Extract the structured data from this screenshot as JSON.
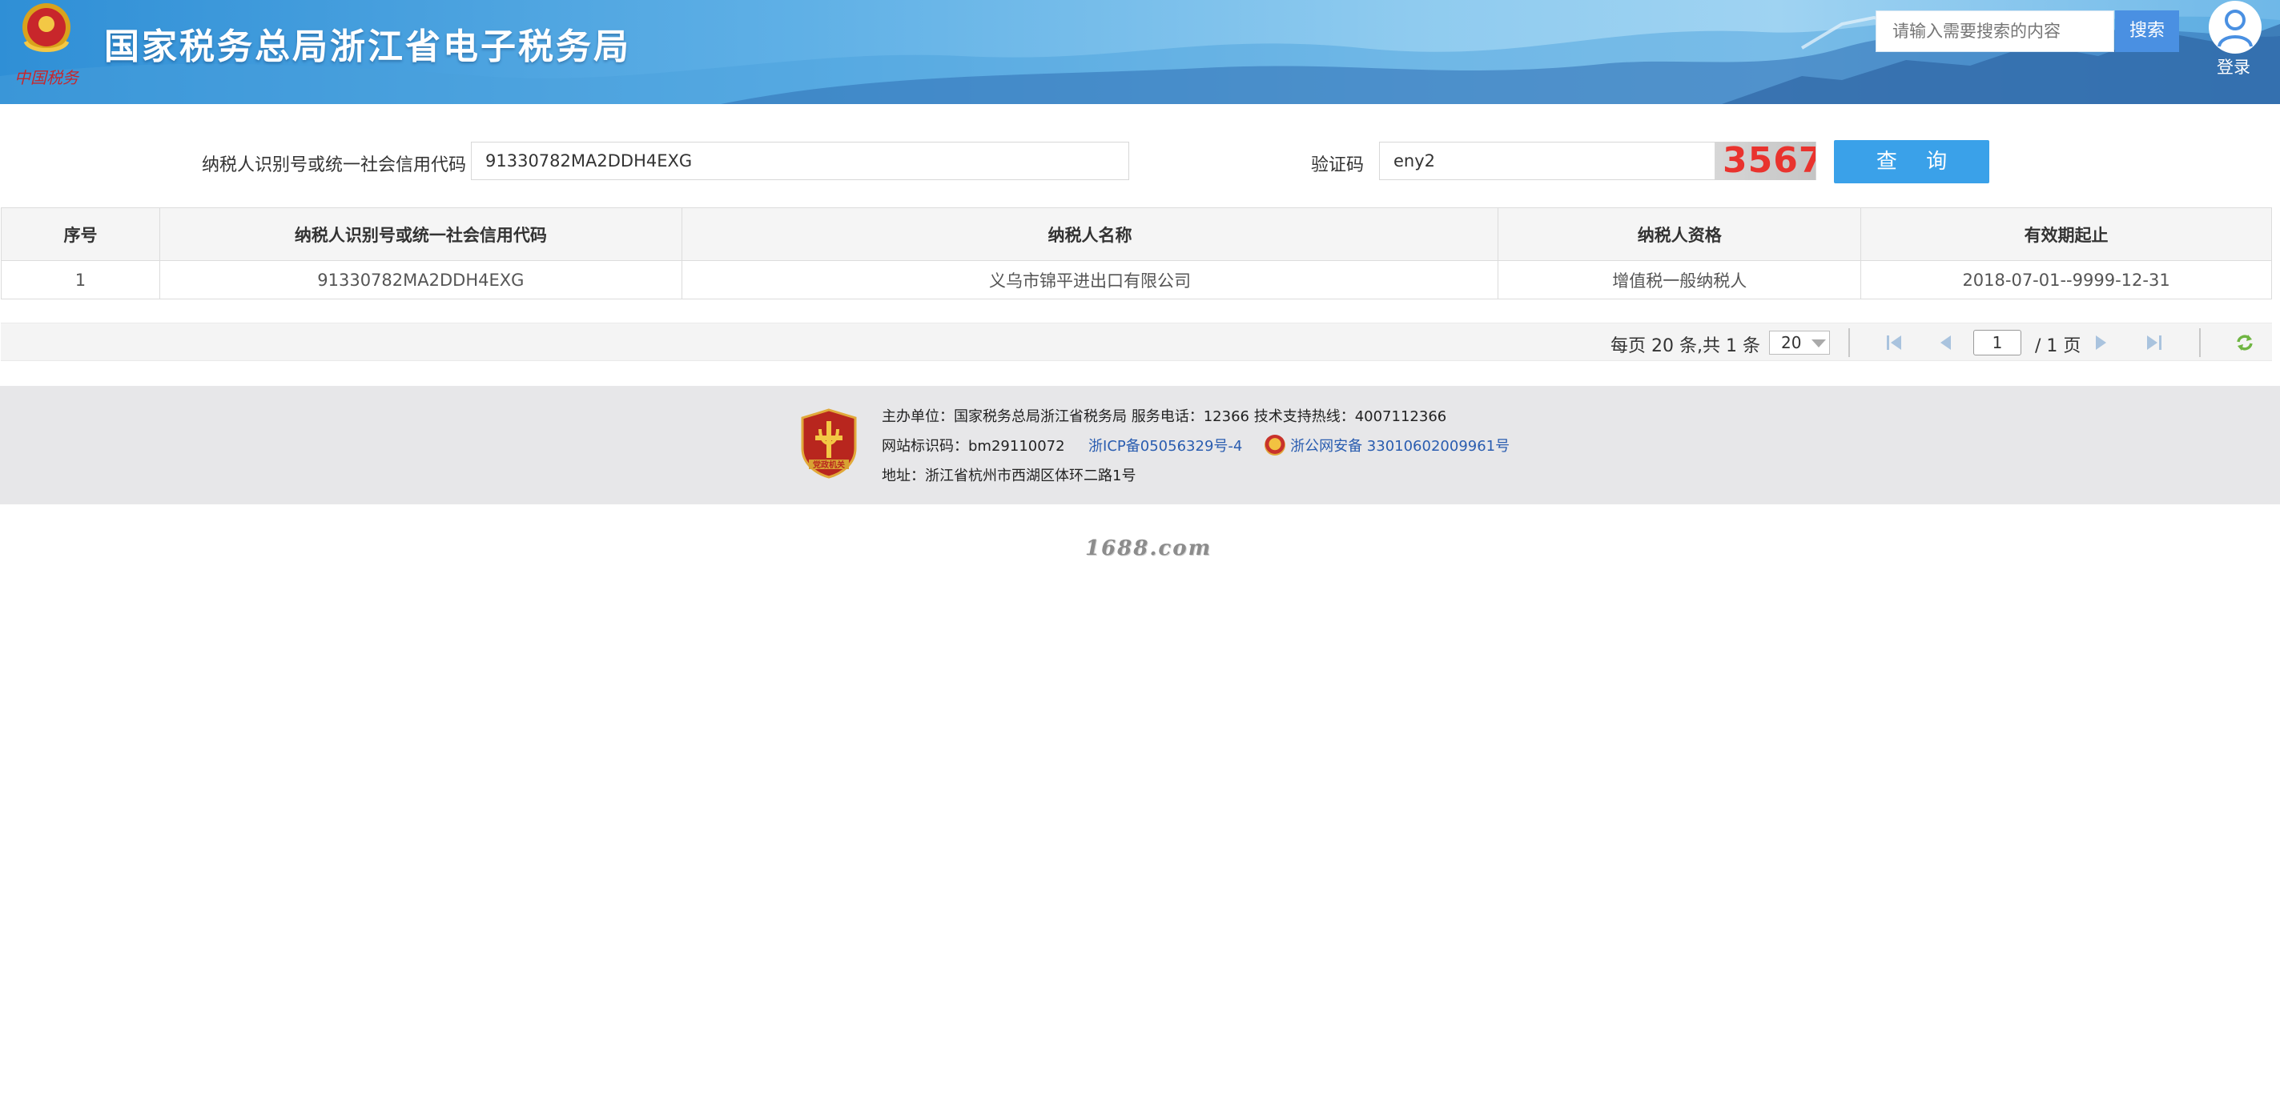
{
  "header": {
    "site_title": "国家税务总局浙江省电子税务局",
    "search_placeholder": "请输入需要搜索的内容",
    "search_button": "搜索",
    "login_label": "登录"
  },
  "query_form": {
    "taxpayer_id_label": "纳税人识别号或统一社会信用代码",
    "taxpayer_id_value": "91330782MA2DDH4EXG",
    "captcha_label": "验证码",
    "captcha_value": "eny2",
    "captcha_image_text": "3567",
    "query_button": "查 询"
  },
  "results_table": {
    "columns": [
      "序号",
      "纳税人识别号或统一社会信用代码",
      "纳税人名称",
      "纳税人资格",
      "有效期起止"
    ],
    "rows": [
      [
        "1",
        "91330782MA2DDH4EXG",
        "义乌市锦平进出口有限公司",
        "增值税一般纳税人",
        "2018-07-01--9999-12-31"
      ]
    ]
  },
  "pagination": {
    "summary": "每页 20 条,共 1 条",
    "page_size": "20",
    "current_page": "1",
    "total_pages": "/ 1 页"
  },
  "footer": {
    "line1": "主办单位：国家税务总局浙江省税务局     服务电话：12366     技术支持热线：4007112366",
    "site_code": "网站标识码：bm29110072",
    "icp": "浙ICP备05056329号-4",
    "police": "浙公网安备 33010602009961号",
    "address": "地址：浙江省杭州市西湖区体环二路1号",
    "badge_text": "党政机关"
  },
  "watermark": "1688.com",
  "colors": {
    "banner_blue": "#2f8fd6",
    "search_button": "#4a90e2",
    "query_button": "#3aa1e9",
    "captcha_digits": "#e9332e",
    "footer_bg": "#e7e7e9",
    "link": "#2a5db0"
  },
  "icons": [
    "emblem-icon",
    "user-avatar-icon",
    "first-page-icon",
    "prev-page-icon",
    "next-page-icon",
    "last-page-icon",
    "refresh-icon",
    "party-badge-icon",
    "police-badge-icon"
  ]
}
